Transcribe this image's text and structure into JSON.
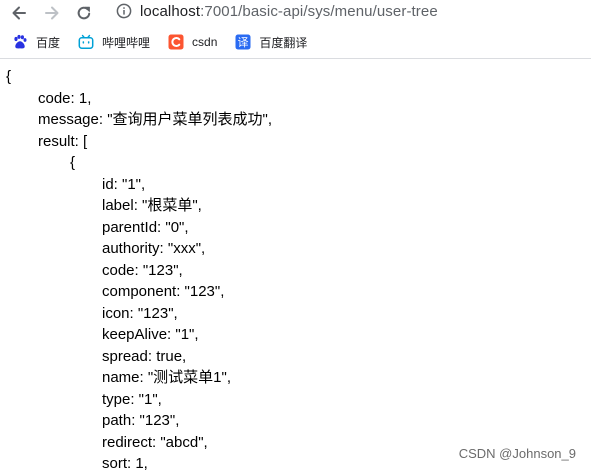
{
  "browser": {
    "url_host": "localhost",
    "url_rest": ":7001/basic-api/sys/menu/user-tree"
  },
  "bookmarks": [
    {
      "label": "百度",
      "icon": "baidu-paw-icon",
      "color": "#2932e1"
    },
    {
      "label": "哔哩哔哩",
      "icon": "bilibili-tv-icon",
      "color": "#00a1d6"
    },
    {
      "label": "csdn",
      "icon": "csdn-c-icon",
      "color": "#fc5531"
    },
    {
      "label": "百度翻译",
      "icon": "baidu-translate-icon",
      "color": "#2a6bf2"
    }
  ],
  "json_lines": [
    {
      "indent": 0,
      "text": "{"
    },
    {
      "indent": 1,
      "text": "code: 1,"
    },
    {
      "indent": 1,
      "text": "message: \"查询用户菜单列表成功\","
    },
    {
      "indent": 1,
      "text": "result: ["
    },
    {
      "indent": 2,
      "text": "{"
    },
    {
      "indent": 3,
      "text": "id: \"1\","
    },
    {
      "indent": 3,
      "text": "label: \"根菜单\","
    },
    {
      "indent": 3,
      "text": "parentId: \"0\","
    },
    {
      "indent": 3,
      "text": "authority: \"xxx\","
    },
    {
      "indent": 3,
      "text": "code: \"123\","
    },
    {
      "indent": 3,
      "text": "component: \"123\","
    },
    {
      "indent": 3,
      "text": "icon: \"123\","
    },
    {
      "indent": 3,
      "text": "keepAlive: \"1\","
    },
    {
      "indent": 3,
      "text": "spread: true,"
    },
    {
      "indent": 3,
      "text": "name: \"测试菜单1\","
    },
    {
      "indent": 3,
      "text": "type: \"1\","
    },
    {
      "indent": 3,
      "text": "path: \"123\","
    },
    {
      "indent": 3,
      "text": "redirect: \"abcd\","
    },
    {
      "indent": 3,
      "text": "sort: 1,"
    }
  ],
  "watermark": "CSDN @Johnson_9"
}
